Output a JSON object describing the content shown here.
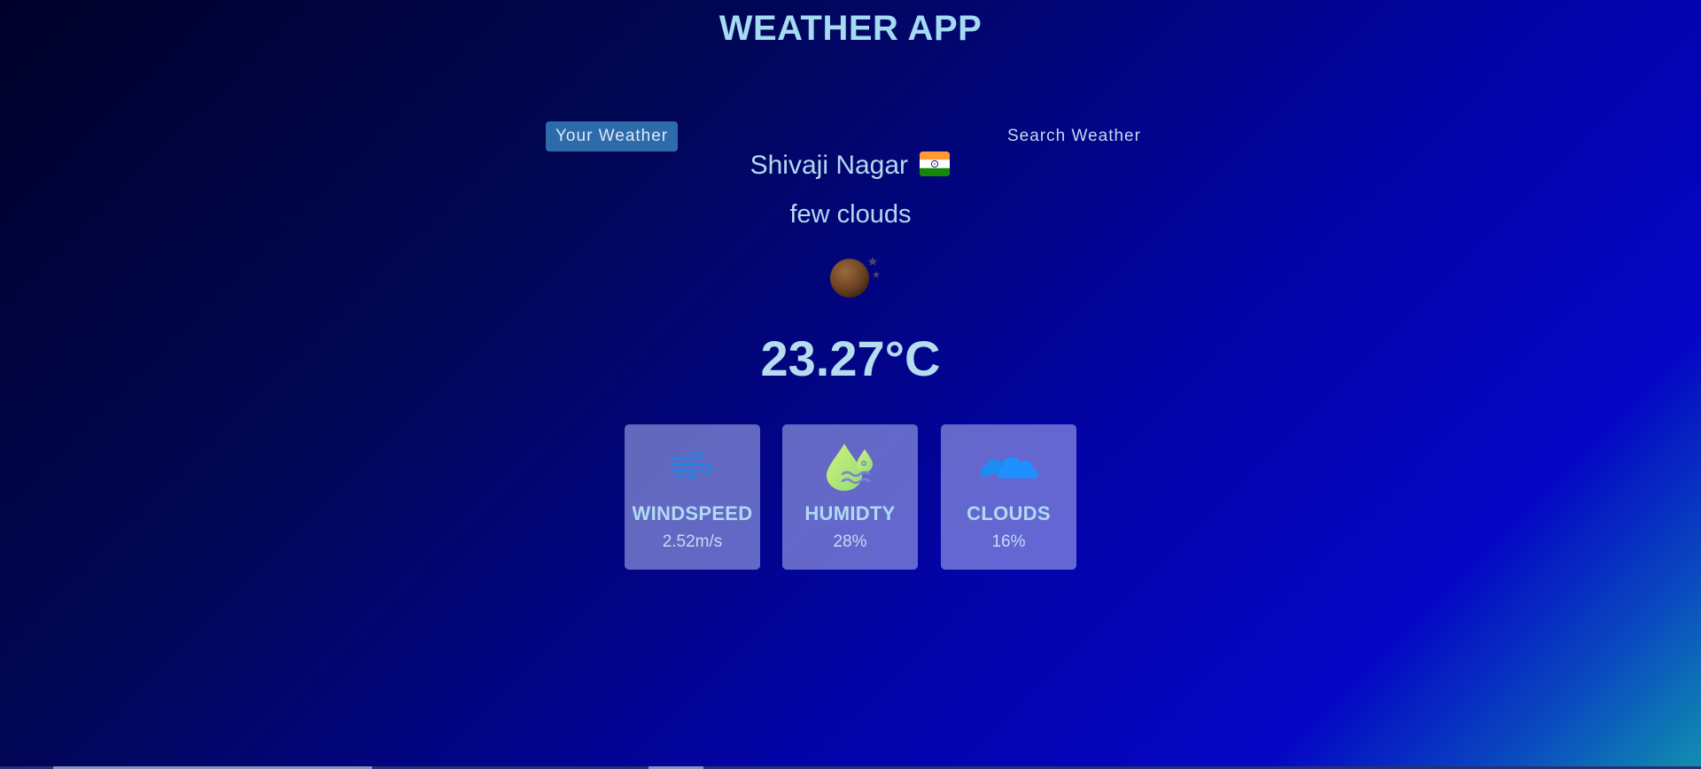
{
  "header": {
    "title": "WEATHER APP"
  },
  "tabs": [
    {
      "label": "Your Weather",
      "active": true
    },
    {
      "label": "Search Weather",
      "active": false
    }
  ],
  "weather": {
    "city": "Shivaji Nagar",
    "country_flag_icon": "india-flag-icon",
    "description": "few clouds",
    "condition_icon": "few-clouds-night-icon",
    "temperature": "23.27°C"
  },
  "stats": [
    {
      "icon": "wind-icon",
      "label": "WINDSPEED",
      "value": "2.52m/s"
    },
    {
      "icon": "humidity-drop-icon",
      "label": "HUMIDTY",
      "value": "28%"
    },
    {
      "icon": "cloud-icon",
      "label": "CLOUDS",
      "value": "16%"
    }
  ],
  "colors": {
    "accent": "#2e6bab",
    "text": "#a9d6f0",
    "card_background": "#7f83d9"
  }
}
